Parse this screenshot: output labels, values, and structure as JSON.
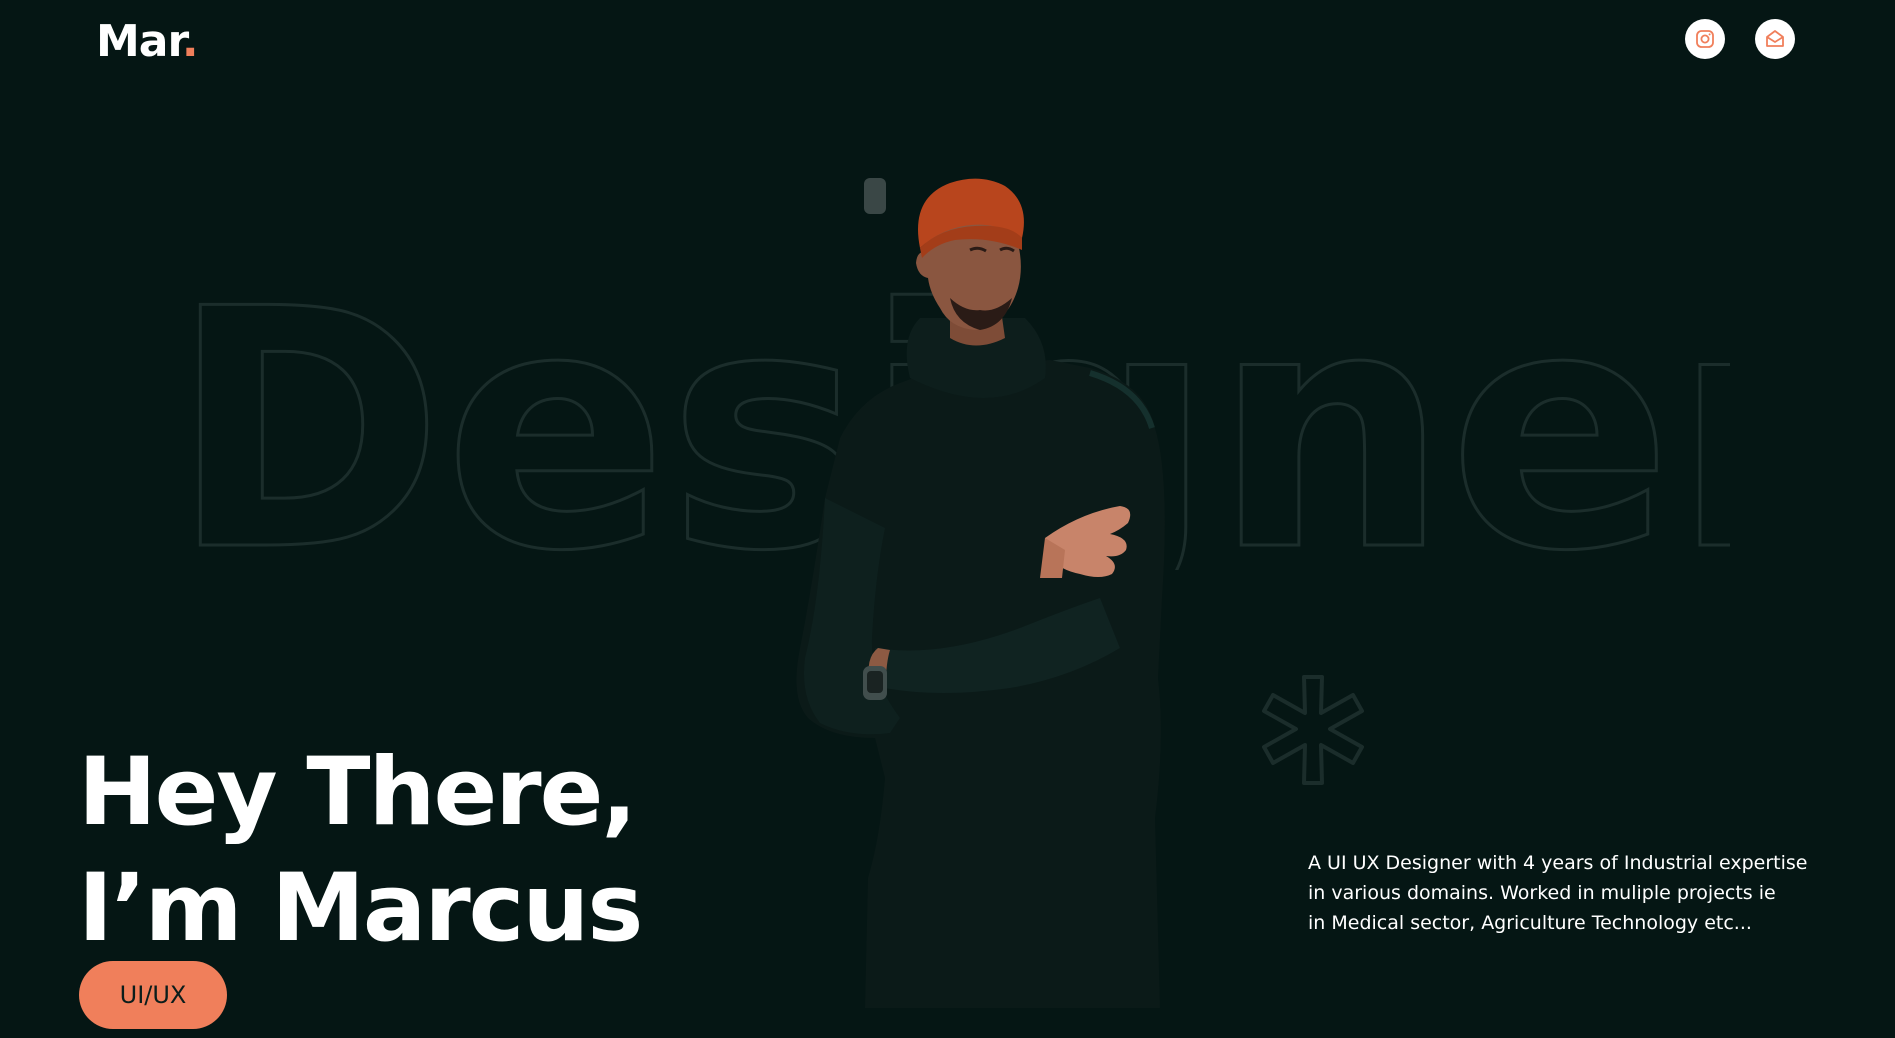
{
  "header": {
    "logo_text": "Mar",
    "logo_dot": ".",
    "social": [
      {
        "name": "instagram",
        "icon": "instagram-icon"
      },
      {
        "name": "email",
        "icon": "mail-icon"
      }
    ]
  },
  "hero": {
    "background_word": "Designer",
    "greeting_line1": "Hey There,",
    "greeting_line2": "I’m Marcus",
    "role_label": "UI/UX",
    "bio_line1": "A UI UX Designer with 4 years of Industrial expertise",
    "bio_line2": "in various domains. Worked in muliple projects ie",
    "bio_line3": "in Medical sector, Agriculture Technology etc..."
  },
  "colors": {
    "background": "#051614",
    "accent": "#f07f5b",
    "text": "#ffffff",
    "outline": "#1b2d2b"
  }
}
